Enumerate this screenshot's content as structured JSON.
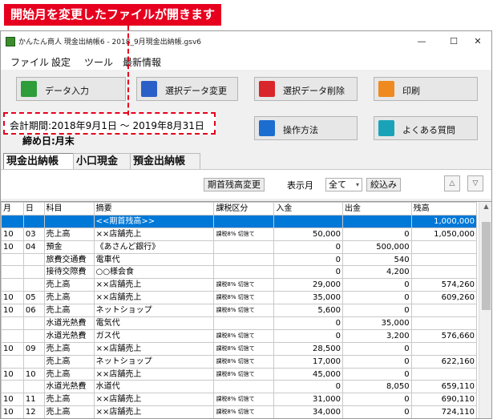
{
  "callout": {
    "text": "開始月を変更したファイルが開きます"
  },
  "window": {
    "title": "かんたん商人 現金出納帳6 - 2018_9月現金出納帳.gsv6",
    "controls": {
      "minimize": "—",
      "maximize": "☐",
      "close": "✕"
    }
  },
  "menu": [
    "ファイル",
    "設定",
    "ツール",
    "最新情報"
  ],
  "toolbar": {
    "data_entry": "データ入力",
    "change_selected": "選択データ変更",
    "delete_selected": "選択データ削除",
    "print": "印刷",
    "how_to": "操作方法",
    "faq": "よくある質問"
  },
  "period": {
    "text": "会計期間:2018年9月1日 ～ 2019年8月31日",
    "closing": "締め日:月末"
  },
  "tabs": [
    "現金出納帳",
    "小口現金",
    "預金出納帳"
  ],
  "filter": {
    "opening_balance_button": "期首残高変更",
    "month_label": "表示月",
    "month_value": "全て",
    "filter_button": "絞込み"
  },
  "ledger": {
    "columns": [
      "月",
      "日",
      "科目",
      "摘要",
      "課税区分",
      "入金",
      "出金",
      "残高"
    ],
    "opening_row": {
      "summary": "<<期首残高>>",
      "balance": "1,000,000"
    },
    "rows": [
      {
        "month": "10",
        "day": "03",
        "account": "売上高",
        "summary": "××店舗売上",
        "tax": "課税8% 切捨て",
        "in": "50,000",
        "out": "0",
        "balance": "1,050,000"
      },
      {
        "month": "10",
        "day": "04",
        "account": "預金",
        "summary": "《あさんど銀行》",
        "tax": "",
        "in": "0",
        "out": "500,000",
        "balance": ""
      },
      {
        "month": "",
        "day": "",
        "account": "旅費交通費",
        "summary": "電車代",
        "tax": "",
        "in": "0",
        "out": "540",
        "balance": ""
      },
      {
        "month": "",
        "day": "",
        "account": "接待交際費",
        "summary": "○○様会食",
        "tax": "",
        "in": "0",
        "out": "4,200",
        "balance": ""
      },
      {
        "month": "",
        "day": "",
        "account": "売上高",
        "summary": "××店舗売上",
        "tax": "課税8% 切捨て",
        "in": "29,000",
        "out": "0",
        "balance": "574,260"
      },
      {
        "month": "10",
        "day": "05",
        "account": "売上高",
        "summary": "××店舗売上",
        "tax": "課税8% 切捨て",
        "in": "35,000",
        "out": "0",
        "balance": "609,260"
      },
      {
        "month": "10",
        "day": "06",
        "account": "売上高",
        "summary": "ネットショップ",
        "tax": "課税8% 切捨て",
        "in": "5,600",
        "out": "0",
        "balance": ""
      },
      {
        "month": "",
        "day": "",
        "account": "水道光熱費",
        "summary": "電気代",
        "tax": "",
        "in": "0",
        "out": "35,000",
        "balance": ""
      },
      {
        "month": "",
        "day": "",
        "account": "水道光熱費",
        "summary": "ガス代",
        "tax": "課税8% 切捨て",
        "in": "0",
        "out": "3,200",
        "balance": "576,660"
      },
      {
        "month": "10",
        "day": "09",
        "account": "売上高",
        "summary": "××店舗売上",
        "tax": "課税8% 切捨て",
        "in": "28,500",
        "out": "0",
        "balance": ""
      },
      {
        "month": "",
        "day": "",
        "account": "売上高",
        "summary": "ネットショップ",
        "tax": "課税8% 切捨て",
        "in": "17,000",
        "out": "0",
        "balance": "622,160"
      },
      {
        "month": "10",
        "day": "10",
        "account": "売上高",
        "summary": "××店舗売上",
        "tax": "課税8% 切捨て",
        "in": "45,000",
        "out": "0",
        "balance": ""
      },
      {
        "month": "",
        "day": "",
        "account": "水道光熱費",
        "summary": "水道代",
        "tax": "",
        "in": "0",
        "out": "8,050",
        "balance": "659,110"
      },
      {
        "month": "10",
        "day": "11",
        "account": "売上高",
        "summary": "××店舗売上",
        "tax": "課税8% 切捨て",
        "in": "31,000",
        "out": "0",
        "balance": "690,110"
      },
      {
        "month": "10",
        "day": "12",
        "account": "売上高",
        "summary": "××店舗売上",
        "tax": "課税8% 切捨て",
        "in": "34,000",
        "out": "0",
        "balance": "724,110"
      }
    ]
  },
  "colors": {
    "callout": "#e6001e",
    "selection": "#0078d7"
  }
}
